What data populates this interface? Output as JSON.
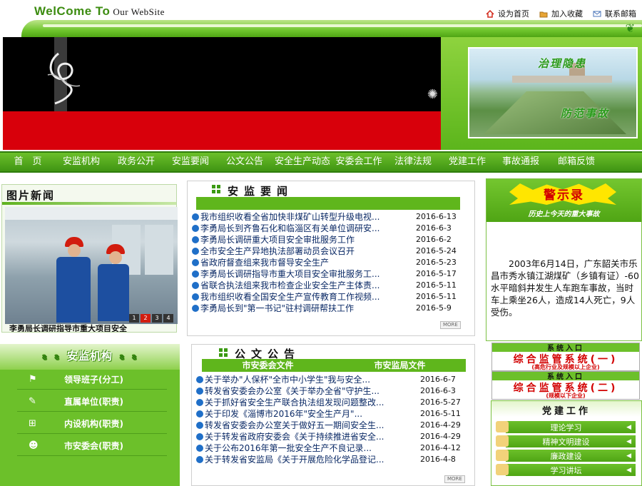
{
  "header": {
    "welcome": "WelCome To",
    "welcome_sub": "Our WebSite",
    "links": [
      {
        "label": "设为首页",
        "icon": "home-icon"
      },
      {
        "label": "加入收藏",
        "icon": "folder-icon"
      },
      {
        "label": "联系邮箱",
        "icon": "mail-icon"
      }
    ]
  },
  "banner": {
    "calligraphy_1": "治理隐患",
    "calligraphy_2": "防范事故"
  },
  "nav": [
    "首　页",
    "安监机构",
    "政务公开",
    "安监要闻",
    "公文公告",
    "安全生产动态",
    "安委会工作",
    "法律法规",
    "党建工作",
    "事故通报",
    "邮箱反馈"
  ],
  "photo_news": {
    "title": "图片新闻",
    "caption": "李勇局长调研指导市重大项目安全",
    "pages": [
      "1",
      "2",
      "3",
      "4"
    ],
    "active_page": "2"
  },
  "agency": {
    "title": "安监机构",
    "items": [
      {
        "label": "领导班子(分工)",
        "icon": "flag-icon"
      },
      {
        "label": "直属单位(职责)",
        "icon": "pen-icon"
      },
      {
        "label": "内设机构(职责)",
        "icon": "network-icon"
      },
      {
        "label": "市安委会(职责)",
        "icon": "person-icon"
      }
    ]
  },
  "news": {
    "title": "安监要闻",
    "more": "MORE",
    "items": [
      {
        "title": "我市组织收看全省加快非煤矿山转型升级电视...",
        "date": "2016-6-13"
      },
      {
        "title": "李勇局长到齐鲁石化和临淄区有关单位调研安...",
        "date": "2016-6-3"
      },
      {
        "title": "李勇局长调研重大项目安全审批服务工作",
        "date": "2016-6-2"
      },
      {
        "title": "全市安全生产异地执法部署动员会议召开",
        "date": "2016-5-24"
      },
      {
        "title": "省政府督查组来我市督导安全生产",
        "date": "2016-5-23"
      },
      {
        "title": "李勇局长调研指导市重大项目安全审批服务工...",
        "date": "2016-5-17"
      },
      {
        "title": "省联合执法组来我市检查企业安全生产主体责...",
        "date": "2016-5-11"
      },
      {
        "title": "我市组织收看全国安全生产宣传教育工作视频...",
        "date": "2016-5-11"
      },
      {
        "title": "李勇局长到\"第一书记\"驻村调研帮扶工作",
        "date": "2016-5-9"
      }
    ]
  },
  "notices": {
    "title": "公文公告",
    "tabs": [
      "市安委会文件",
      "市安监局文件"
    ],
    "more": "MORE",
    "items": [
      {
        "title": "关于举办\"人保杯\"全市中小学生\"我与安全...",
        "date": "2016-6-7"
      },
      {
        "title": "转发省安委会办公室《关于举办全省\"守护生...",
        "date": "2016-6-3"
      },
      {
        "title": "关于抓好省安全生产联合执法组发现问题整改...",
        "date": "2016-5-27"
      },
      {
        "title": "关于印发《淄博市2016年\"安全生产月\"...",
        "date": "2016-5-11"
      },
      {
        "title": "转发省安委会办公室关于做好五一期间安全生...",
        "date": "2016-4-29"
      },
      {
        "title": "关于转发省政府安委会《关于持续推进省安全...",
        "date": "2016-4-29"
      },
      {
        "title": "关于公布2016年第一批安全生产不良记录...",
        "date": "2016-4-12"
      },
      {
        "title": "关于转发省安监局《关于开展危险化学品登记...",
        "date": "2016-4-8"
      }
    ]
  },
  "alarm": {
    "title": "警示录",
    "subtitle": "历史上今天的重大事故",
    "text": "2003年6月14日，广东韶关市乐昌市秀水镇江湖煤矿（乡镇有证）-60水平暗斜井发生人车跑车事故，当时车上乘坐26人，造成14人死亡，9人受伤。"
  },
  "systems": [
    {
      "caption": "系统入口",
      "main": "综合监管系统(一)",
      "sub": "(高危行业及规模以上企业)"
    },
    {
      "caption": "系统入口",
      "main": "综合监管系统(二)",
      "sub": "(规模以下企业)"
    }
  ],
  "party": {
    "title": "党建工作",
    "items": [
      "理论学习",
      "精神文明建设",
      "廉政建设",
      "学习讲坛"
    ]
  },
  "colors": {
    "brand_green": "#5fb61c",
    "alarm_red": "#d20000",
    "link_blue": "#0b2a66"
  }
}
